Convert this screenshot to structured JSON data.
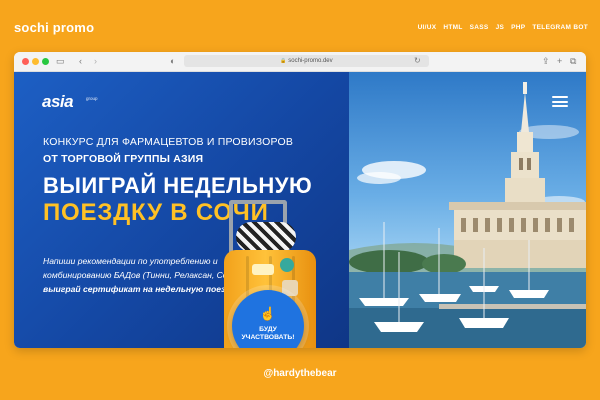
{
  "header": {
    "brand": "sochi promo",
    "tags": [
      "UI/UX",
      "HTML",
      "SASS",
      "JS",
      "PHP",
      "TELEGRAM BOT"
    ]
  },
  "browser": {
    "url": "sochi-promo.dev"
  },
  "site": {
    "logo": {
      "text": "asia",
      "subtext": "group"
    },
    "subtitle_1": "КОНКУРС ДЛЯ ФАРМАЦЕВТОВ И ПРОВИЗОРОВ",
    "subtitle_2": "ОТ ТОРГОВОЙ ГРУППЫ АЗИЯ",
    "headline_1": "ВЫИГРАЙ НЕДЕЛЬНУЮ",
    "headline_2": "ПОЕЗДКУ В СОЧИ",
    "body_normal": "Напиши рекомендации по употреблению и комбинированию БАДов (Тинни, Релаксан, Соверен)",
    "body_bold": "и выиграй сертификат на недельную поездку в Сочи",
    "cta_label": "БУДУ УЧАСТВОВАТЬ!"
  },
  "footer": {
    "credit": "@hardythebear"
  },
  "colors": {
    "background": "#F7A51C",
    "panel_blue": "#1A55B8",
    "accent_yellow": "#FFC125",
    "cta_blue": "#1F73E0"
  },
  "icons": [
    "traffic-lights",
    "sidebar-icon",
    "back-icon",
    "forward-icon",
    "shield-icon",
    "lock-icon",
    "reload-icon",
    "share-icon",
    "new-tab-icon",
    "tabs-icon",
    "menu-icon",
    "tap-hand-icon"
  ]
}
